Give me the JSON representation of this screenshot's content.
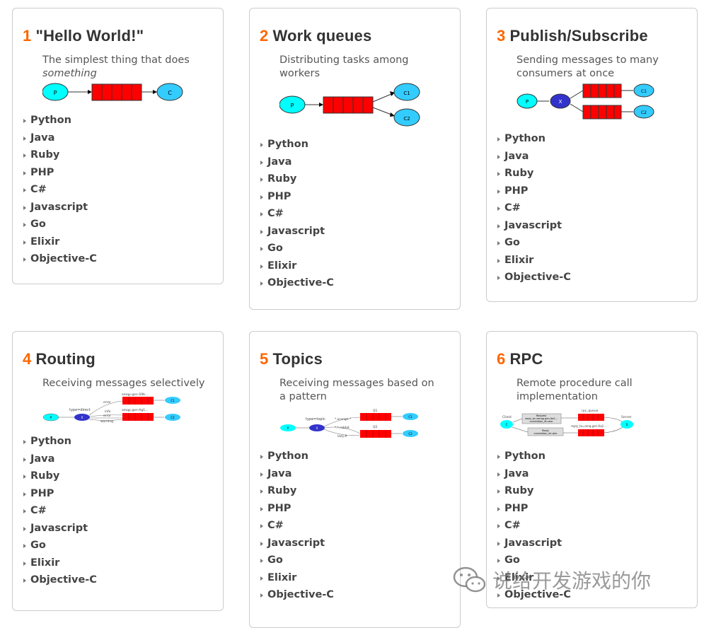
{
  "tutorials": [
    {
      "number": "1",
      "title": "\"Hello World!\"",
      "description": "The simplest thing that does",
      "description_em": "something",
      "diagram": {
        "producer": "P",
        "consumer": "C"
      },
      "languages": [
        "Python",
        "Java",
        "Ruby",
        "PHP",
        "C#",
        "Javascript",
        "Go",
        "Elixir",
        "Objective-C"
      ]
    },
    {
      "number": "2",
      "title": "Work queues",
      "description": "Distributing tasks among workers",
      "diagram": {
        "producer": "P",
        "consumers": [
          "C1",
          "C2"
        ]
      },
      "languages": [
        "Python",
        "Java",
        "Ruby",
        "PHP",
        "C#",
        "Javascript",
        "Go",
        "Elixir",
        "Objective-C"
      ]
    },
    {
      "number": "3",
      "title": "Publish/Subscribe",
      "description": "Sending messages to many consumers at once",
      "diagram": {
        "producer": "P",
        "exchange": "X",
        "consumers": [
          "C1",
          "C2"
        ]
      },
      "languages": [
        "Python",
        "Java",
        "Ruby",
        "PHP",
        "C#",
        "Javascript",
        "Go",
        "Elixir",
        "Objective-C"
      ]
    },
    {
      "number": "4",
      "title": "Routing",
      "description": "Receiving messages selectively",
      "diagram": {
        "producer": "P",
        "exchange": "X",
        "type": "type=direct",
        "queues": [
          "amqp.gen-S9b...",
          "amqp.gen-Ag1..."
        ],
        "bindings": [
          "error",
          "info",
          "error",
          "warning"
        ],
        "consumers": [
          "C1",
          "C2"
        ]
      },
      "languages": [
        "Python",
        "Java",
        "Ruby",
        "PHP",
        "C#",
        "Javascript",
        "Go",
        "Elixir",
        "Objective-C"
      ]
    },
    {
      "number": "5",
      "title": "Topics",
      "description": "Receiving messages based on a pattern",
      "diagram": {
        "producer": "P",
        "exchange": "X",
        "type": "type=topic",
        "queues": [
          "Q1",
          "Q2"
        ],
        "bindings": [
          "*.orange.*",
          "*.*.rabbit",
          "lazy.#"
        ],
        "consumers": [
          "C1",
          "C2"
        ]
      },
      "languages": [
        "Python",
        "Java",
        "Ruby",
        "PHP",
        "C#",
        "Javascript",
        "Go",
        "Elixir",
        "Objective-C"
      ]
    },
    {
      "number": "6",
      "title": "RPC",
      "description": "Remote procedure call implementation",
      "diagram": {
        "client": "Client",
        "server": "Server",
        "client_node": "C",
        "server_node": "S",
        "queues": [
          "rpc_queue",
          "reply_to=amq.gen-Xa2..."
        ],
        "request": [
          "Request",
          "reply_to=amqp.gen-Xa2...",
          "correlation_id=abc"
        ],
        "reply": [
          "Reply",
          "correlation_id=abc"
        ]
      },
      "languages": [
        "Python",
        "Java",
        "Ruby",
        "PHP",
        "C#",
        "Javascript",
        "Go",
        "Elixir",
        "Objective-C"
      ]
    }
  ],
  "colors": {
    "accent": "#ff6600",
    "queue": "#ff0000",
    "producer": "#00ffff",
    "consumer": "#33ccff",
    "exchange": "#3333cc"
  },
  "watermark": {
    "icon": "wechat-icon",
    "text": "说给开发游戏的你"
  }
}
